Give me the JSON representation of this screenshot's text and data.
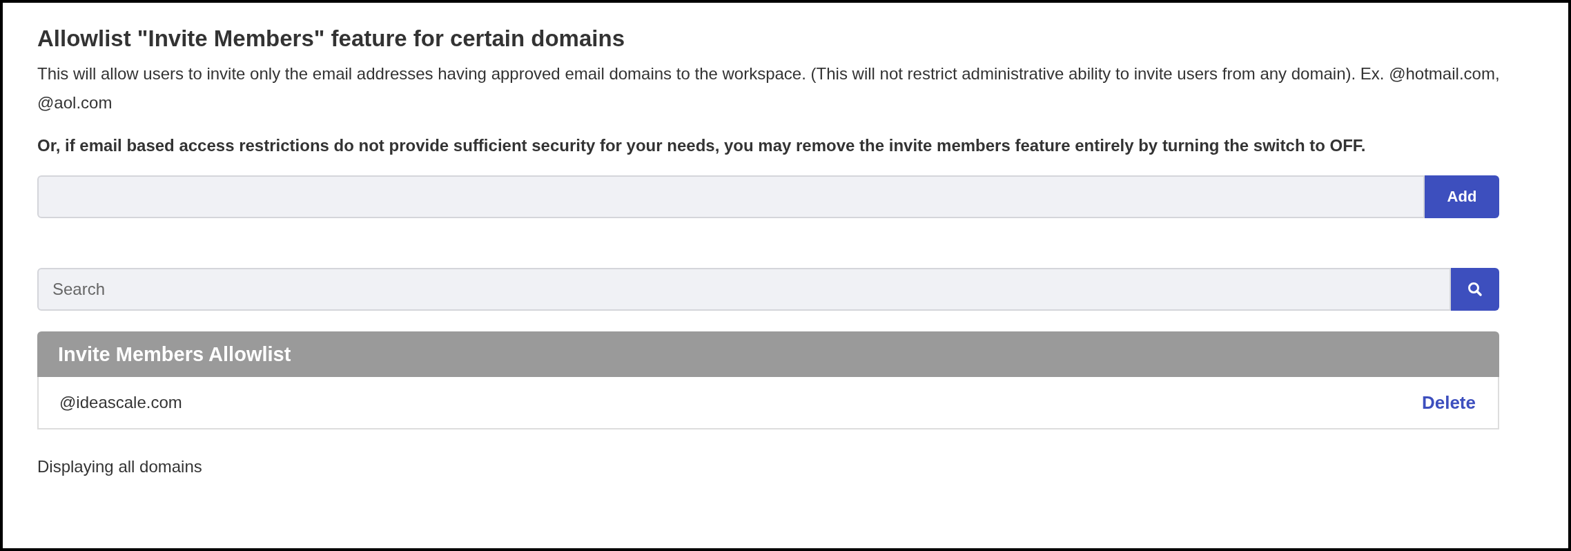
{
  "title": "Allowlist \"Invite Members\" feature for certain domains",
  "description": "This will allow users to invite only the email addresses having approved email domains to the workspace. (This will not restrict administrative ability to invite users from any domain). Ex. @hotmail.com, @aol.com",
  "warning": "Or, if email based access restrictions do not provide sufficient security for your needs, you may remove the invite members feature entirely by turning the switch to OFF.",
  "add_button": "Add",
  "search": {
    "placeholder": "Search"
  },
  "table": {
    "title": "Invite Members Allowlist",
    "rows": [
      {
        "domain": "@ideascale.com",
        "action": "Delete"
      }
    ]
  },
  "footer": "Displaying all domains"
}
